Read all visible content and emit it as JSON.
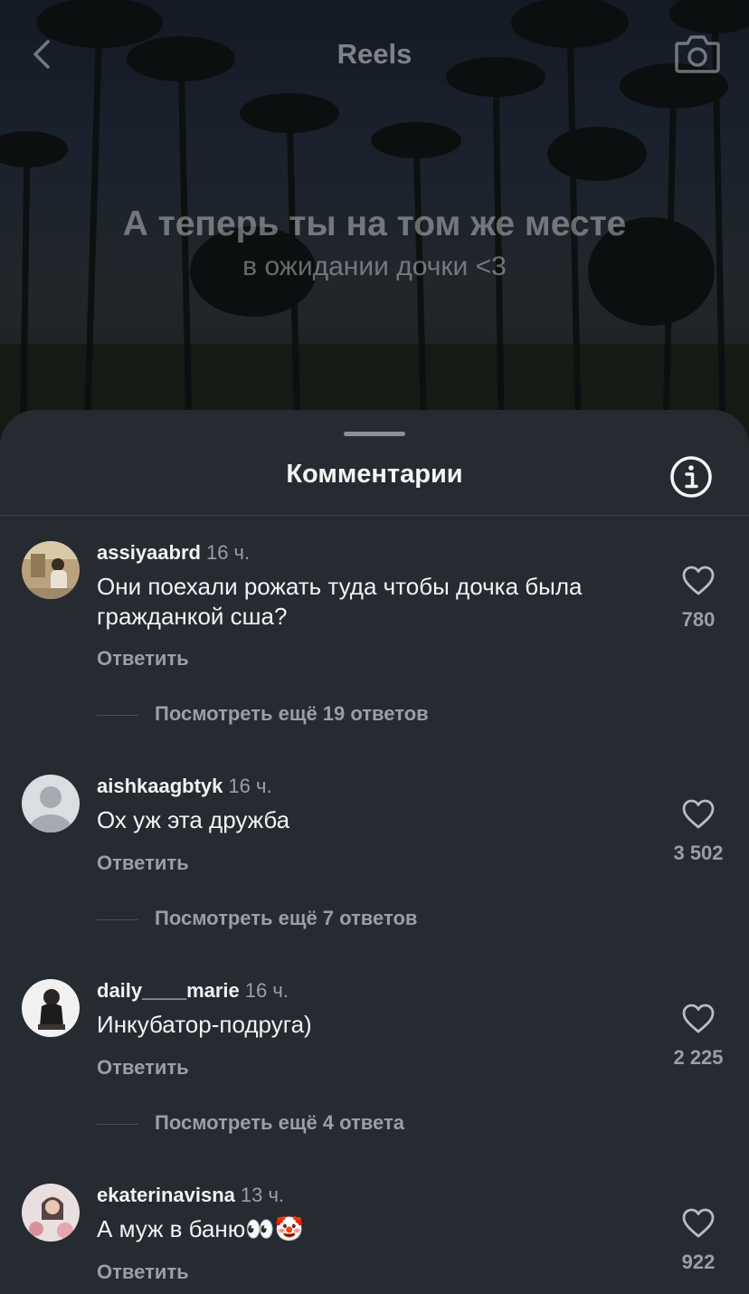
{
  "header": {
    "title": "Reels"
  },
  "reel": {
    "caption_main": "А теперь ты на том же месте",
    "caption_sub": "в ожидании дочки <3"
  },
  "sheet": {
    "title": "Комментарии"
  },
  "comments": [
    {
      "username": "assiyaabrd",
      "time": "16 ч.",
      "text": "Они поехали рожать туда чтобы дочка была гражданкой сша?",
      "reply_label": "Ответить",
      "view_replies": "Посмотреть ещё 19 ответов",
      "likes": "780"
    },
    {
      "username": "aishkaagbtyk",
      "time": "16 ч.",
      "text": "Ох уж эта дружба",
      "reply_label": "Ответить",
      "view_replies": "Посмотреть ещё 7 ответов",
      "likes": "3 502"
    },
    {
      "username": "daily____marie",
      "time": "16 ч.",
      "text": "Инкубатор-подруга)",
      "reply_label": "Ответить",
      "view_replies": "Посмотреть ещё 4 ответа",
      "likes": "2 225"
    },
    {
      "username": "ekaterinavisna",
      "time": "13 ч.",
      "text": "А муж в баню👀🤡",
      "reply_label": "Ответить",
      "likes": "922"
    }
  ],
  "icons": {
    "back": "chevron-left-icon",
    "camera": "camera-icon",
    "info": "info-icon",
    "like": "heart-icon"
  },
  "colors": {
    "sheet_background": "#262a31",
    "primary_text": "#f2f2f2",
    "secondary_text": "#9a9ea6"
  }
}
